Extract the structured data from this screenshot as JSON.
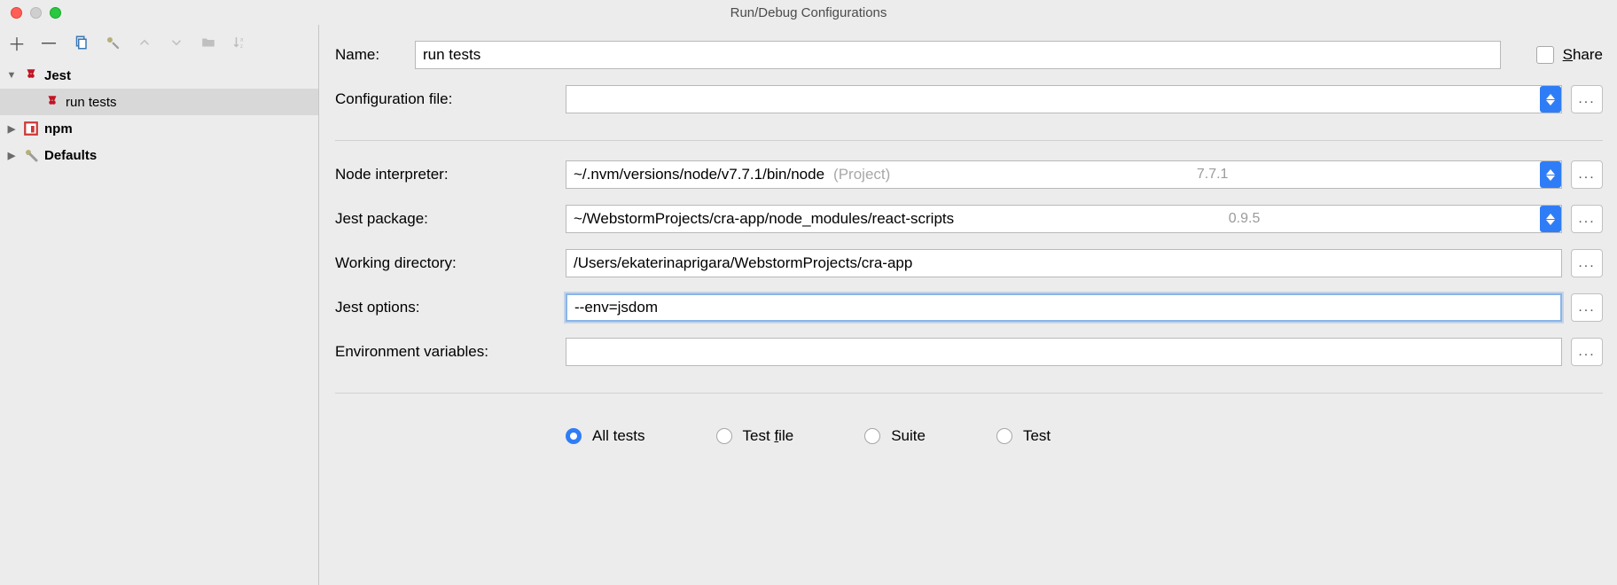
{
  "window": {
    "title": "Run/Debug Configurations"
  },
  "sidebar": {
    "items": [
      {
        "label": "Jest",
        "kind": "jest",
        "bold": true,
        "expanded": true
      },
      {
        "label": "run tests",
        "kind": "jest",
        "indent": 1,
        "selected": true
      },
      {
        "label": "npm",
        "kind": "npm",
        "bold": true,
        "expanded": false
      },
      {
        "label": "Defaults",
        "kind": "defaults",
        "bold": true,
        "expanded": false
      }
    ]
  },
  "form": {
    "name_label": "Name:",
    "name_value": "run tests",
    "share_label": "Share",
    "config_file_label": "Configuration file:",
    "config_file_value": "",
    "node_label": "Node interpreter:",
    "node_value": "~/.nvm/versions/node/v7.7.1/bin/node",
    "node_hint": "(Project)",
    "node_version": "7.7.1",
    "jest_pkg_label": "Jest package:",
    "jest_pkg_value": "~/WebstormProjects/cra-app/node_modules/react-scripts",
    "jest_pkg_version": "0.9.5",
    "workdir_label": "Working directory:",
    "workdir_value": "/Users/ekaterinaprigara/WebstormProjects/cra-app",
    "jest_opts_label": "Jest options:",
    "jest_opts_value": "--env=jsdom",
    "env_label": "Environment variables:",
    "env_value": ""
  },
  "radios": {
    "all_tests": "All tests",
    "test_file_prefix": "Test ",
    "test_file_mnemonic": "f",
    "test_file_suffix": "ile",
    "suite": "Suite",
    "test": "Test",
    "selected": "all_tests"
  }
}
